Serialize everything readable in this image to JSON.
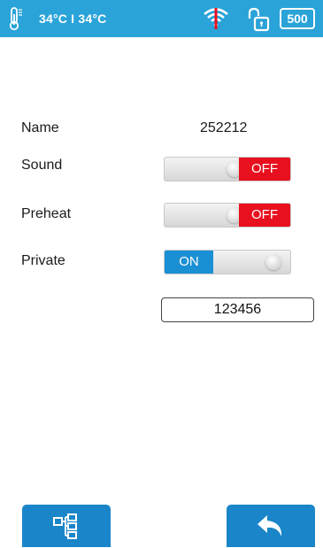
{
  "status_bar": {
    "temperature": "34°C I 34°C",
    "counter": "500",
    "icons": [
      "thermometer-icon",
      "wifi-off-icon",
      "unlocked-icon"
    ],
    "background": "#2aa3d8"
  },
  "settings": {
    "name_label": "Name",
    "name_value": "252212",
    "sound_label": "Sound",
    "sound_state": "OFF",
    "preheat_label": "Preheat",
    "preheat_state": "OFF",
    "private_label": "Private",
    "private_state": "ON",
    "pin_value": "123456"
  },
  "bottom": {
    "left_button_icon": "network-tree-icon",
    "right_button_icon": "back-arrow-icon",
    "button_color": "#1a86c9"
  },
  "colors": {
    "off": "#e8101e",
    "on": "#1b8fd3"
  }
}
